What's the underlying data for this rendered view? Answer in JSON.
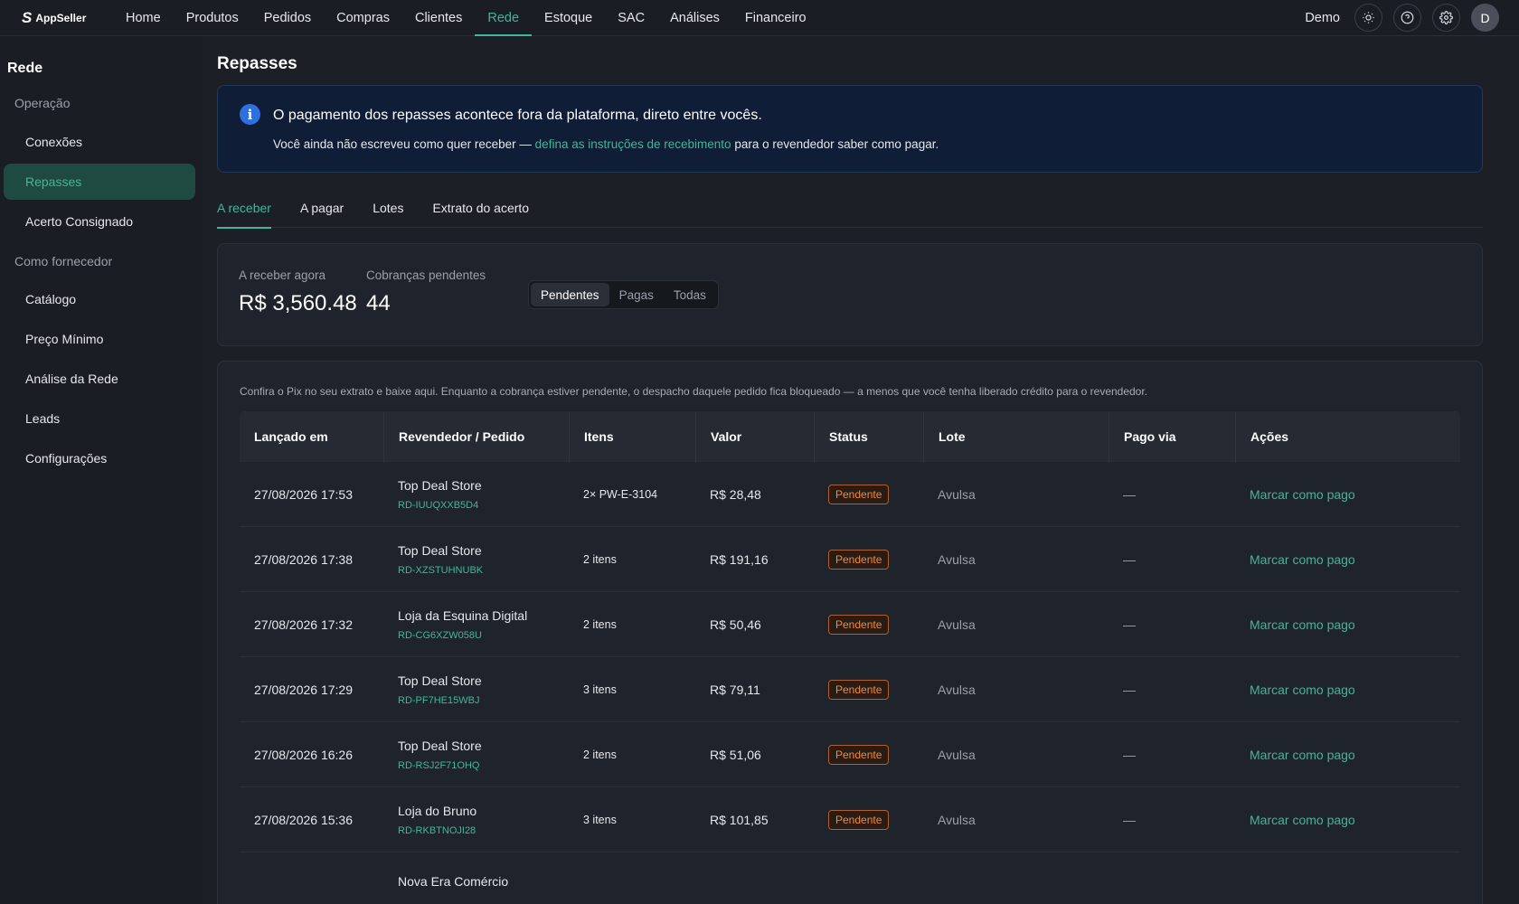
{
  "app": {
    "logo_text": "AppSeller",
    "user_label": "Demo",
    "avatar_initial": "D"
  },
  "nav": [
    {
      "label": "Home"
    },
    {
      "label": "Produtos"
    },
    {
      "label": "Pedidos"
    },
    {
      "label": "Compras"
    },
    {
      "label": "Clientes"
    },
    {
      "label": "Rede"
    },
    {
      "label": "Estoque"
    },
    {
      "label": "SAC"
    },
    {
      "label": "Análises"
    },
    {
      "label": "Financeiro"
    }
  ],
  "sidebar": {
    "title": "Rede",
    "group_operacao": "Operação",
    "group_fornecedor": "Como fornecedor",
    "items": [
      {
        "label": "Conexões"
      },
      {
        "label": "Repasses"
      },
      {
        "label": "Acerto Consignado"
      },
      {
        "label": "Catálogo"
      },
      {
        "label": "Preço Mínimo"
      },
      {
        "label": "Análise da Rede"
      },
      {
        "label": "Leads"
      },
      {
        "label": "Configurações"
      }
    ]
  },
  "page": {
    "title": "Repasses"
  },
  "banner": {
    "title": "O pagamento dos repasses acontece fora da plataforma, direto entre vocês.",
    "text_before": "Você ainda não escreveu como quer receber — ",
    "link": "defina as instruções de recebimento",
    "text_after": " para o revendedor saber como pagar."
  },
  "tabs": [
    {
      "label": "A receber"
    },
    {
      "label": "A pagar"
    },
    {
      "label": "Lotes"
    },
    {
      "label": "Extrato do acerto"
    }
  ],
  "summary": {
    "receber_label": "A receber agora",
    "receber_value": "R$ 3,560.48",
    "pendentes_label": "Cobranças pendentes",
    "pendentes_value": "44",
    "filters": [
      {
        "label": "Pendentes"
      },
      {
        "label": "Pagas"
      },
      {
        "label": "Todas"
      }
    ]
  },
  "table": {
    "hint": "Confira o Pix no seu extrato e baixe aqui. Enquanto a cobrança estiver pendente, o despacho daquele pedido fica bloqueado — a menos que você tenha liberado crédito para o revendedor.",
    "headers": [
      "Lançado em",
      "Revendedor / Pedido",
      "Itens",
      "Valor",
      "Status",
      "Lote",
      "Pago via",
      "Ações"
    ],
    "rows": [
      {
        "date": "27/08/2026 17:53",
        "seller": "Top Deal Store",
        "order": "RD-IUUQXXB5D4",
        "items": "2× PW-E-3104",
        "value": "R$ 28,48",
        "status": "Pendente",
        "lote": "Avulsa",
        "pago": "—",
        "action": "Marcar como pago"
      },
      {
        "date": "27/08/2026 17:38",
        "seller": "Top Deal Store",
        "order": "RD-XZSTUHNUBK",
        "items": "2 itens",
        "value": "R$ 191,16",
        "status": "Pendente",
        "lote": "Avulsa",
        "pago": "—",
        "action": "Marcar como pago"
      },
      {
        "date": "27/08/2026 17:32",
        "seller": "Loja da Esquina Digital",
        "order": "RD-CG6XZW058U",
        "items": "2 itens",
        "value": "R$ 50,46",
        "status": "Pendente",
        "lote": "Avulsa",
        "pago": "—",
        "action": "Marcar como pago"
      },
      {
        "date": "27/08/2026 17:29",
        "seller": "Top Deal Store",
        "order": "RD-PF7HE15WBJ",
        "items": "3 itens",
        "value": "R$ 79,11",
        "status": "Pendente",
        "lote": "Avulsa",
        "pago": "—",
        "action": "Marcar como pago"
      },
      {
        "date": "27/08/2026 16:26",
        "seller": "Top Deal Store",
        "order": "RD-RSJ2F71OHQ",
        "items": "2 itens",
        "value": "R$ 51,06",
        "status": "Pendente",
        "lote": "Avulsa",
        "pago": "—",
        "action": "Marcar como pago"
      },
      {
        "date": "27/08/2026 15:36",
        "seller": "Loja do Bruno",
        "order": "RD-RKBTNOJI28",
        "items": "3 itens",
        "value": "R$ 101,85",
        "status": "Pendente",
        "lote": "Avulsa",
        "pago": "—",
        "action": "Marcar como pago"
      },
      {
        "date": "",
        "seller": "Nova Era Comércio",
        "order": "",
        "items": "",
        "value": "",
        "status": "",
        "lote": "",
        "pago": "",
        "action": ""
      }
    ]
  },
  "colors": {
    "accent": "#3fb89a",
    "banner_bg": "#0f1d36",
    "badge": "#f08a3c"
  },
  "icons": {
    "theme": "sun-icon",
    "help": "help-icon",
    "settings": "gear-icon",
    "info": "info-icon"
  }
}
